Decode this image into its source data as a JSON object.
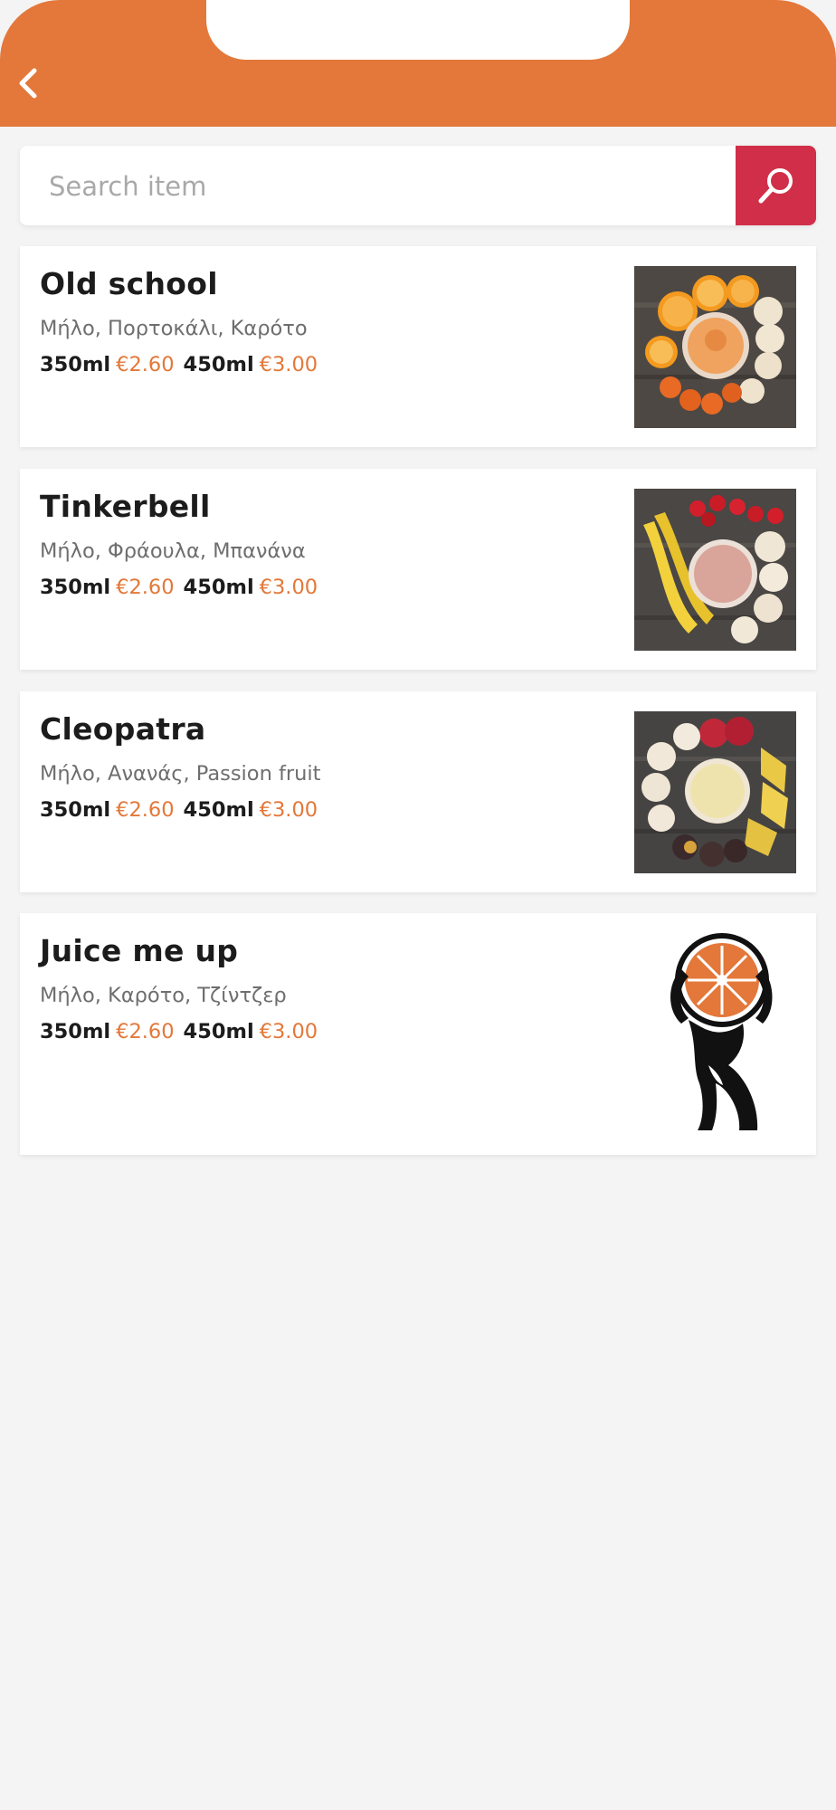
{
  "search": {
    "placeholder": "Search item"
  },
  "products": [
    {
      "name": "Old school",
      "ingredients": "Μήλο, Πορτοκάλι, Καρότο",
      "sizes": [
        {
          "size": "350ml",
          "price": "€2.60"
        },
        {
          "size": "450ml",
          "price": "€3.00"
        }
      ],
      "image": "orange-carrot-smoothie-photo"
    },
    {
      "name": "Tinkerbell",
      "ingredients": "Μήλο, Φράουλα, Μπανάνα",
      "sizes": [
        {
          "size": "350ml",
          "price": "€2.60"
        },
        {
          "size": "450ml",
          "price": "€3.00"
        }
      ],
      "image": "strawberry-banana-smoothie-photo"
    },
    {
      "name": "Cleopatra",
      "ingredients": "Μήλο, Ανανάς, Passion fruit",
      "sizes": [
        {
          "size": "350ml",
          "price": "€2.60"
        },
        {
          "size": "450ml",
          "price": "€3.00"
        }
      ],
      "image": "pineapple-passion-fruit-smoothie-photo"
    },
    {
      "name": "Juice me up",
      "ingredients": "Μήλο, Καρότο, Τζίντζερ",
      "sizes": [
        {
          "size": "350ml",
          "price": "€2.60"
        },
        {
          "size": "450ml",
          "price": "€3.00"
        }
      ],
      "image": "atlas-orange-logo"
    }
  ],
  "colors": {
    "header": "#e3783a",
    "accent": "#e3783a",
    "search_button": "#d12f49",
    "background": "#f4f4f4"
  },
  "icons": {
    "back": "chevron-left-icon",
    "search": "magnifier-icon"
  }
}
